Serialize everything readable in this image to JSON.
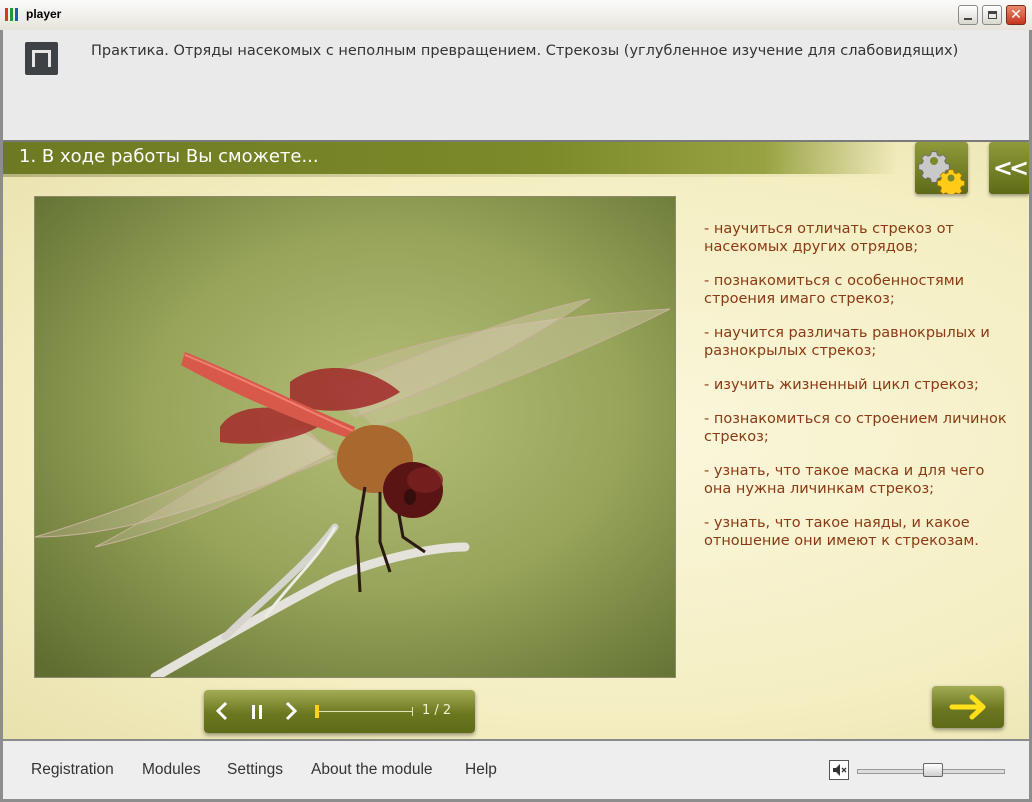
{
  "window": {
    "title": "player",
    "icon_colors": [
      "#d83a1e",
      "#1f9a3a",
      "#1f5ab5"
    ]
  },
  "header": {
    "logo": "module-logo",
    "course_title": "Практика. Отряды насекомых с неполным превращением. Стрекозы (углубленное изучение для слабовидящих)"
  },
  "section": {
    "title": "1. В ходе работы Вы сможете...",
    "settings_icon": "gear-icon",
    "collapse_label": "<<"
  },
  "photo": {
    "subject": "dragonfly-photo"
  },
  "bullets": [
    "- научиться отличать стрекоз от насекомых других отрядов;",
    "- познакомиться с особенностями строения имаго стрекоз;",
    "- научится различать равнокрылых и разнокрылых стрекоз;",
    "- изучить жизненный цикл стрекоз;",
    "- познакомиться со строением личинок стрекоз;",
    "- узнать, что такое маска и для чего она нужна личинкам стрекоз;",
    "- узнать, что такое наяды, и какое отношение они имеют к стрекозам."
  ],
  "player": {
    "counter": "1 / 2",
    "progress": 0.0
  },
  "menu": {
    "items": [
      "Registration",
      "Modules",
      "Settings",
      "About the module",
      "Help"
    ]
  },
  "volume": {
    "level": 0.5,
    "icon": "speaker-mute-icon"
  },
  "colors": {
    "accent_olive": "#6e7a22",
    "bullet_text": "#8a3a14",
    "arrow_yellow": "#ffd11a"
  }
}
